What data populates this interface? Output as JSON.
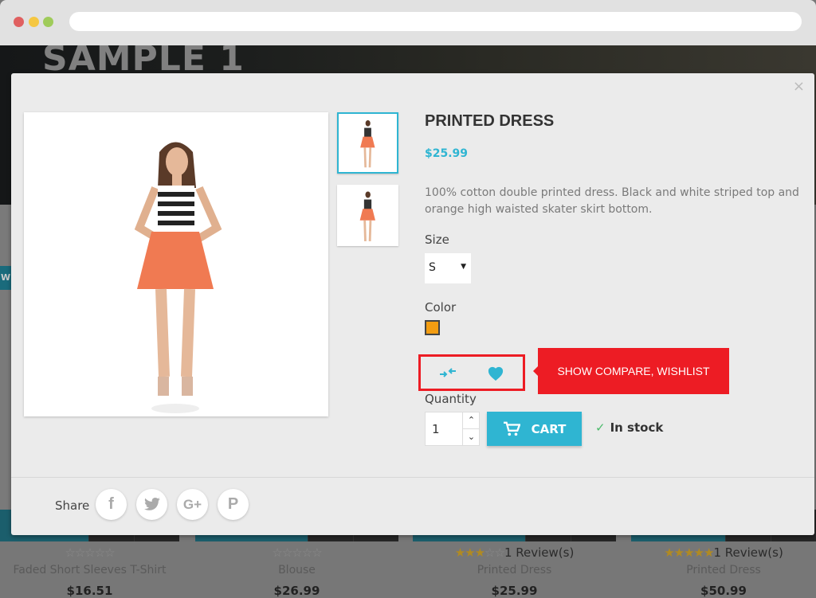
{
  "browser": {
    "dots": [
      "#e06060",
      "#f5c742",
      "#9fcb5a"
    ]
  },
  "hero": {
    "title": "SAMPLE 1"
  },
  "background": {
    "tab_letter": "W",
    "cards": [
      {
        "name": "Faded Short Sleeves T-Shirt",
        "price": "$16.51",
        "rating": 0,
        "reviews": ""
      },
      {
        "name": "Blouse",
        "price": "$26.99",
        "rating": 0,
        "reviews": ""
      },
      {
        "name": "Printed Dress",
        "price": "$25.99",
        "rating": 3,
        "reviews": "1 Review(s)"
      },
      {
        "name": "Printed Dress",
        "price": "$50.99",
        "rating": 5,
        "reviews": "1 Review(s)"
      }
    ]
  },
  "modal": {
    "close": "×",
    "title": "PRINTED DRESS",
    "price": "$25.99",
    "description": "100% cotton double printed dress. Black and white striped top and orange high waisted skater skirt bottom.",
    "size_label": "Size",
    "size_value": "S",
    "color_label": "Color",
    "color_value": "#f39d12",
    "callout": "SHOW COMPARE, WISHLIST",
    "quantity_label": "Quantity",
    "quantity": "1",
    "cart_label": "CART",
    "stock": "In stock",
    "share_label": "Share",
    "social": [
      "facebook",
      "twitter",
      "google-plus",
      "pinterest"
    ],
    "accent": "#2fb5d2"
  }
}
